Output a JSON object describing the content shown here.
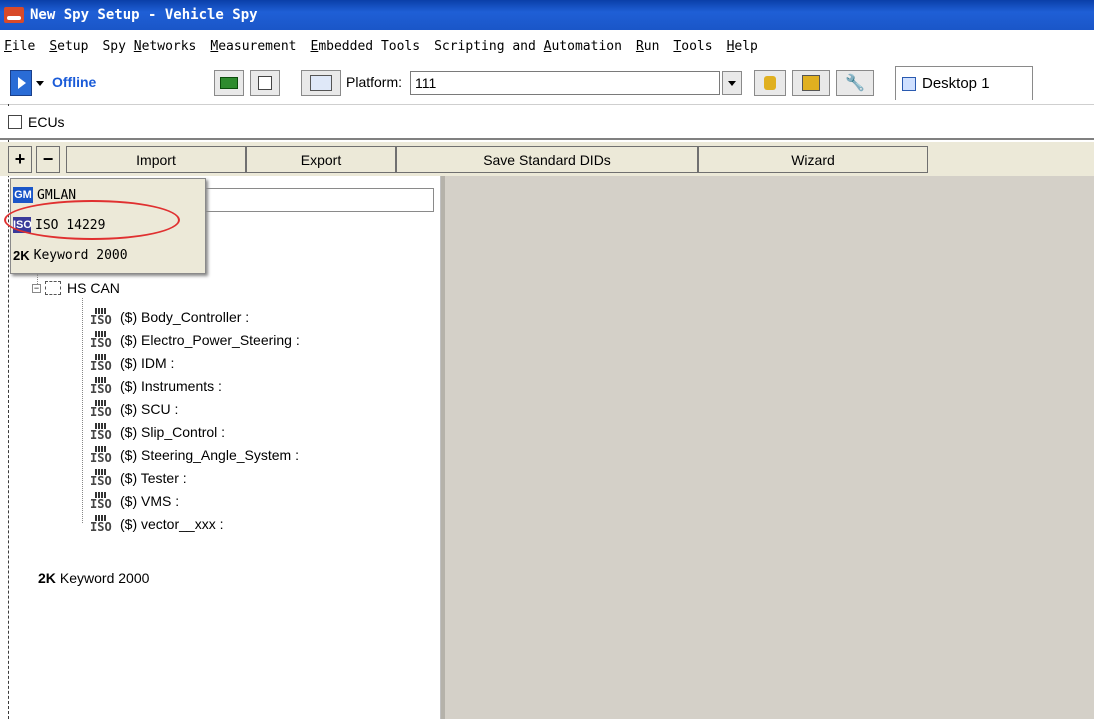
{
  "window": {
    "title": "New Spy Setup - Vehicle Spy"
  },
  "menubar": {
    "items": [
      {
        "label": "File",
        "accel": "F"
      },
      {
        "label": "Setup",
        "accel": "S"
      },
      {
        "label": "Spy Networks",
        "accel": "N"
      },
      {
        "label": "Measurement",
        "accel": "M"
      },
      {
        "label": "Embedded Tools",
        "accel": "E"
      },
      {
        "label": "Scripting and Automation",
        "accel": "A"
      },
      {
        "label": "Run",
        "accel": "R"
      },
      {
        "label": "Tools",
        "accel": "T"
      },
      {
        "label": "Help",
        "accel": "H"
      }
    ]
  },
  "toolbar": {
    "status": "Offline",
    "platform_label": "Platform:",
    "platform_value": "111",
    "desktop_tab": "Desktop 1"
  },
  "ecus": {
    "title": "ECUs",
    "buttons": {
      "add": "+",
      "remove": "−",
      "import": "Import",
      "export": "Export",
      "save_dids": "Save Standard DIDs",
      "wizard": "Wizard"
    },
    "menu": {
      "items": [
        {
          "badge": "GM",
          "label": "GMLAN"
        },
        {
          "badge": "ISO",
          "label": "ISO 14229"
        },
        {
          "badge": "2K",
          "label": "Keyword 2000"
        }
      ]
    },
    "tree": {
      "network": "HS CAN",
      "ecus": [
        "($) Body_Controller :",
        "($) Electro_Power_Steering :",
        "($) IDM :",
        "($) Instruments :",
        "($) SCU :",
        "($) Slip_Control :",
        "($) Steering_Angle_System :",
        "($) Tester :",
        "($) VMS :",
        "($) vector__xxx :"
      ],
      "keyword_badge": "2K",
      "keyword_label": "Keyword 2000"
    }
  },
  "colors": {
    "titlebar": "#1f5fd6",
    "panel_bg": "#ece9d8",
    "right_pane": "#d4d0c8",
    "highlight_ellipse": "#e03030",
    "offline_text": "#1a5bd8"
  },
  "icons": [
    "app-icon",
    "run-icon",
    "hardware-icon",
    "save-icon",
    "platform-icon",
    "database-icon",
    "database-copy-icon",
    "wrench-icon",
    "desktop-icon",
    "ecu-icon",
    "iso-icon",
    "network-icon"
  ]
}
